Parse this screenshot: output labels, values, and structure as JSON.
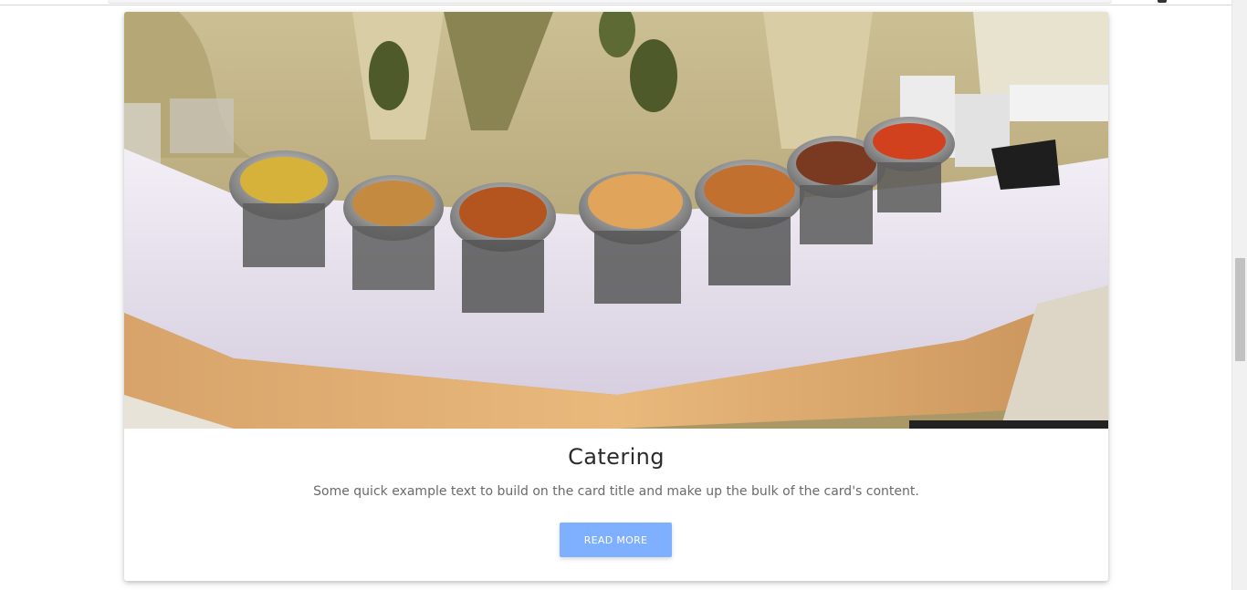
{
  "card": {
    "image_alt": "Buffet table with chafing dishes of food",
    "title": "Catering",
    "text": "Some quick example text to build on the card title and make up the bulk of the card's content.",
    "button_label": "Read more"
  },
  "colors": {
    "button": "#7fb0ff",
    "title": "#2b2b2b",
    "text": "#6a6a6a",
    "background": "#ffffff"
  }
}
